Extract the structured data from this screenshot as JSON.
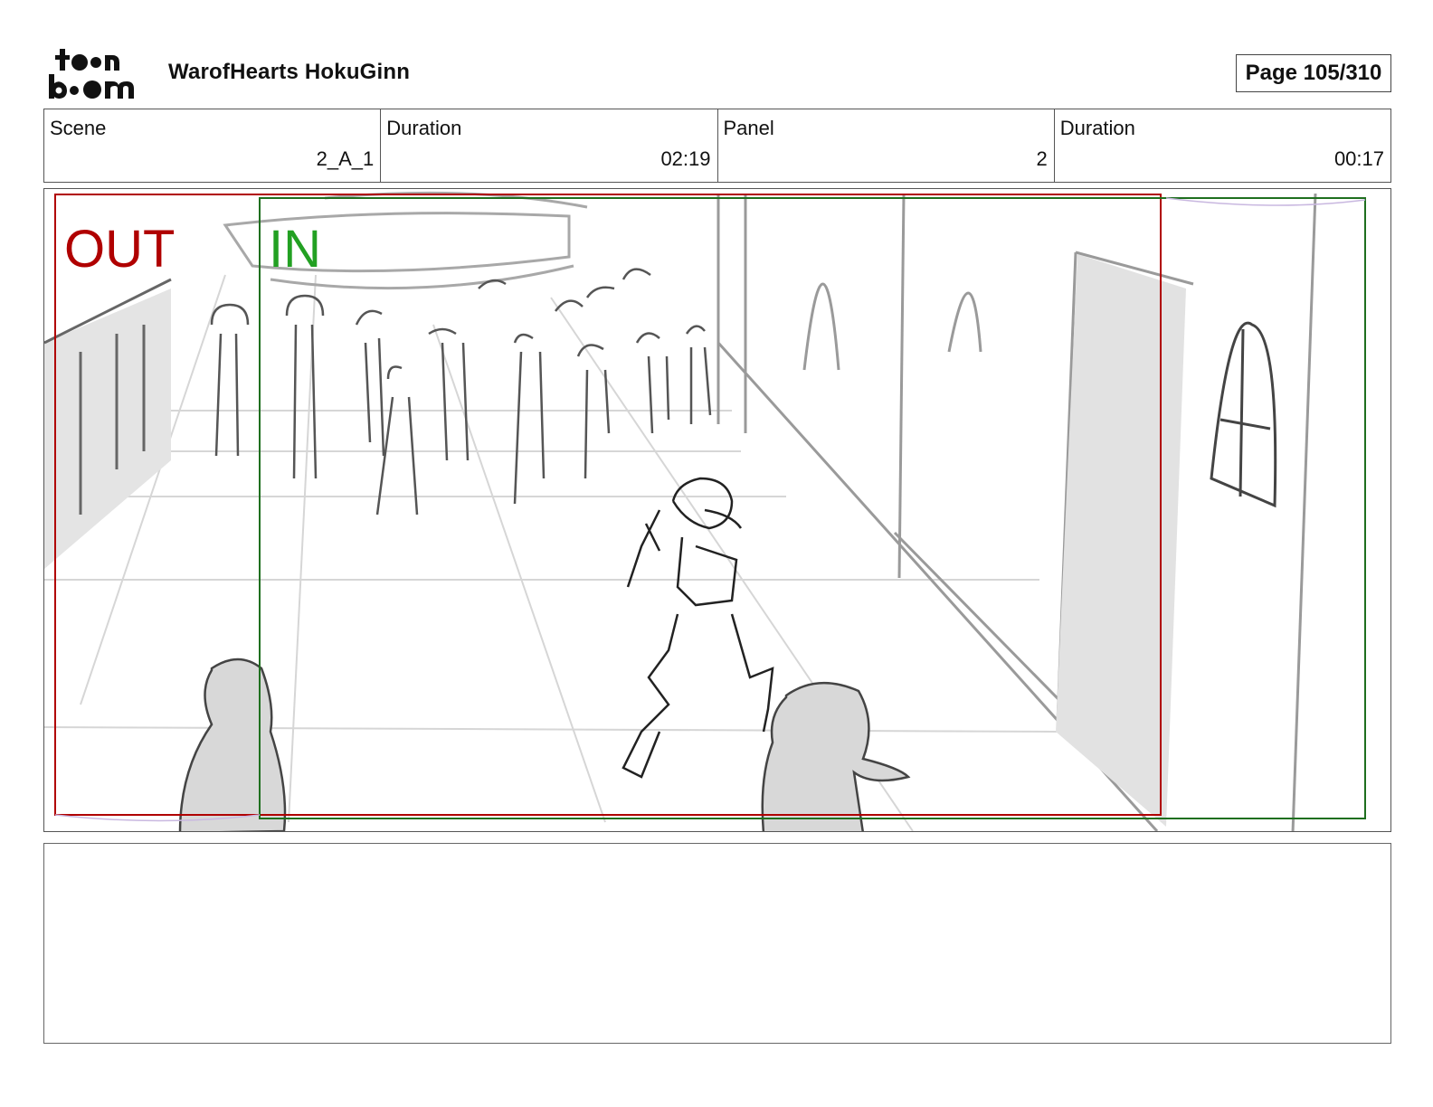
{
  "header": {
    "logo_text": "toon boom",
    "project_title": "WarofHearts HokuGinn",
    "page_label": "Page 105/310"
  },
  "info": {
    "scene_label": "Scene",
    "scene_value": "2_A_1",
    "duration_label": "Duration",
    "duration_value": "02:19",
    "panel_label": "Panel",
    "panel_value": "2",
    "panel_duration_label": "Duration",
    "panel_duration_value": "00:17"
  },
  "panel": {
    "out_label": "OUT",
    "in_label": "IN",
    "out_color": "#b00000",
    "in_color": "#22a022"
  },
  "notes": {
    "text": ""
  }
}
